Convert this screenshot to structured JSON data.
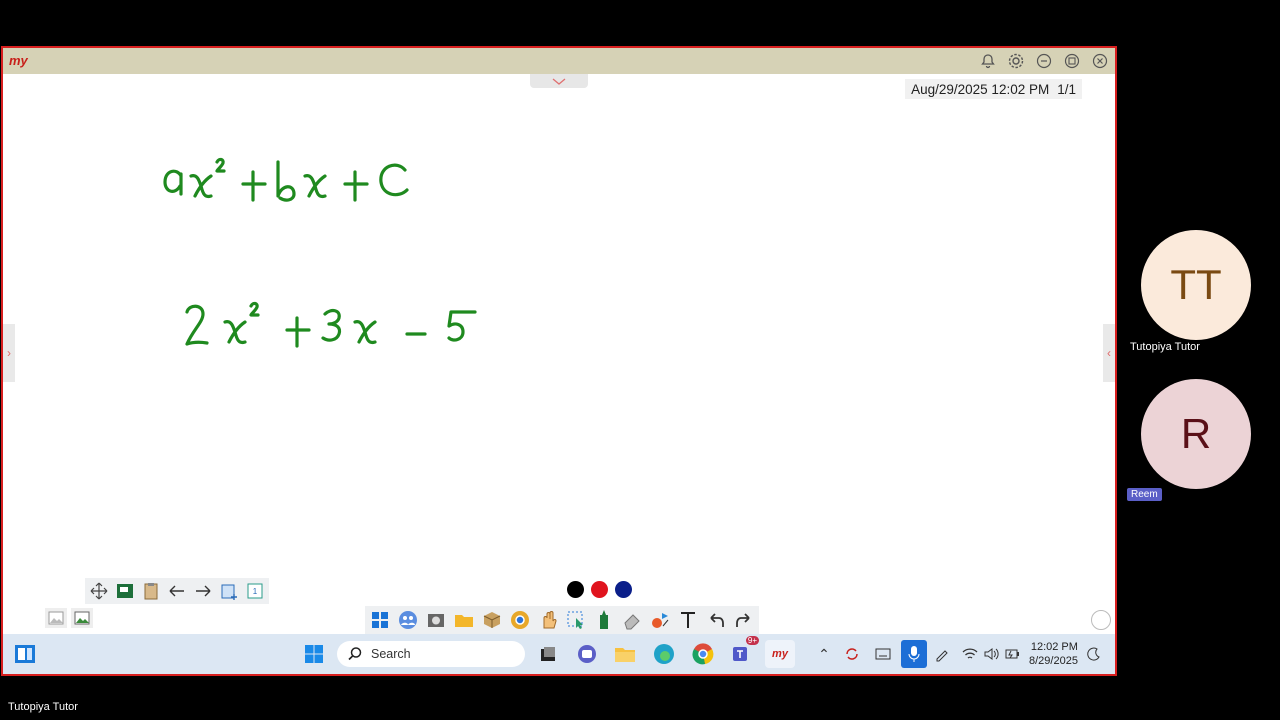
{
  "app": {
    "logo_text": "my"
  },
  "window": {
    "titlebar_icons": [
      "bell-icon",
      "gear-icon",
      "minimize-icon",
      "restore-icon",
      "close-icon"
    ],
    "datetime": "Aug/29/2025  12:02 PM",
    "page_count": "1/1"
  },
  "whiteboard": {
    "ink_color": "#1f8a1f",
    "equations": [
      "ax² + bx + c",
      "2x² + 3x − 5"
    ]
  },
  "pen_colors": [
    "#000000",
    "#e0141e",
    "#0b1f8a"
  ],
  "toolbar_bottom_left": {
    "page_thumb_label": "1"
  },
  "taskbar": {
    "search_placeholder": "Search",
    "teams_badge": "9+",
    "time": "12:02 PM",
    "date": "8/29/2025"
  },
  "participants": [
    {
      "initials": "TT",
      "name": "Tutopiya Tutor",
      "bg": "#fbeadb",
      "fg": "#7a4a12"
    },
    {
      "initials": "R",
      "name": "Reem",
      "bg": "#ecd3d6",
      "fg": "#5a1018"
    }
  ],
  "footer_name": "Tutopiya Tutor"
}
